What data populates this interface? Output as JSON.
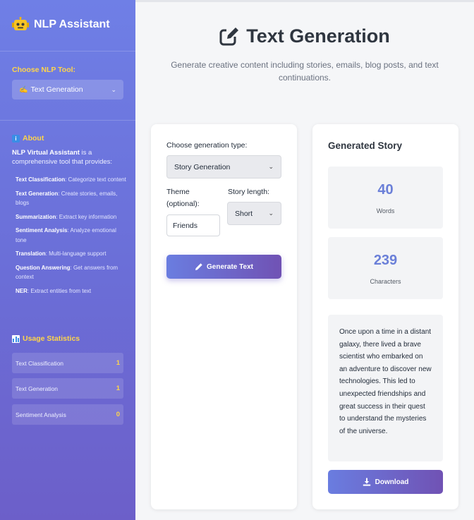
{
  "sidebar": {
    "brand_title": "NLP Assistant",
    "choose_tool_label": "Choose NLP Tool:",
    "tool_select_value": "Text Generation",
    "about_title": "About",
    "about_intro_bold": "NLP Virtual Assistant",
    "about_intro_rest": " is a comprehensive tool that provides:",
    "features": [
      {
        "name": "Text Classification",
        "desc": ": Categorize text content"
      },
      {
        "name": "Text Generation",
        "desc": ": Create stories, emails, blogs"
      },
      {
        "name": "Summarization",
        "desc": ": Extract key information"
      },
      {
        "name": "Sentiment Analysis",
        "desc": ": Analyze emotional tone"
      },
      {
        "name": "Translation",
        "desc": ": Multi-language support"
      },
      {
        "name": "Question Answering",
        "desc": ": Get answers from context"
      },
      {
        "name": "NER",
        "desc": ": Extract entities from text"
      }
    ],
    "stats_title": "Usage Statistics",
    "stats": [
      {
        "label": "Text Classification",
        "count": "1"
      },
      {
        "label": "Text Generation",
        "count": "1"
      },
      {
        "label": "Sentiment Analysis",
        "count": "0"
      }
    ]
  },
  "main": {
    "title": "Text Generation",
    "subtitle": "Generate creative content including stories, emails, blog posts, and text continuations.",
    "form": {
      "type_label": "Choose generation type:",
      "type_value": "Story Generation",
      "theme_label": "Theme (optional):",
      "theme_value": "Friends",
      "length_label": "Story length:",
      "length_value": "Short",
      "generate_button": "Generate Text"
    },
    "result": {
      "title": "Generated Story",
      "words_value": "40",
      "words_label": "Words",
      "chars_value": "239",
      "chars_label": "Characters",
      "story": "Once upon a time in a distant galaxy, there lived a brave scientist who embarked on an adventure to discover new technologies. This led to unexpected friendships and great success in their quest to understand the mysteries of the universe.",
      "download_button": "Download"
    }
  },
  "colors": {
    "sidebar_top": "#6f7fe6",
    "sidebar_bottom": "#6c5fc9",
    "accent_yellow": "#ffd54a",
    "button_start": "#6a7de0",
    "button_end": "#7052b4",
    "stat_number": "#6a7fd8"
  },
  "icons": {
    "brand": "robot-icon",
    "tool": "pen-icon",
    "about": "info-icon",
    "stats": "bar-chart-icon",
    "title": "edit-icon",
    "generate": "pencil-icon",
    "download": "download-icon"
  }
}
